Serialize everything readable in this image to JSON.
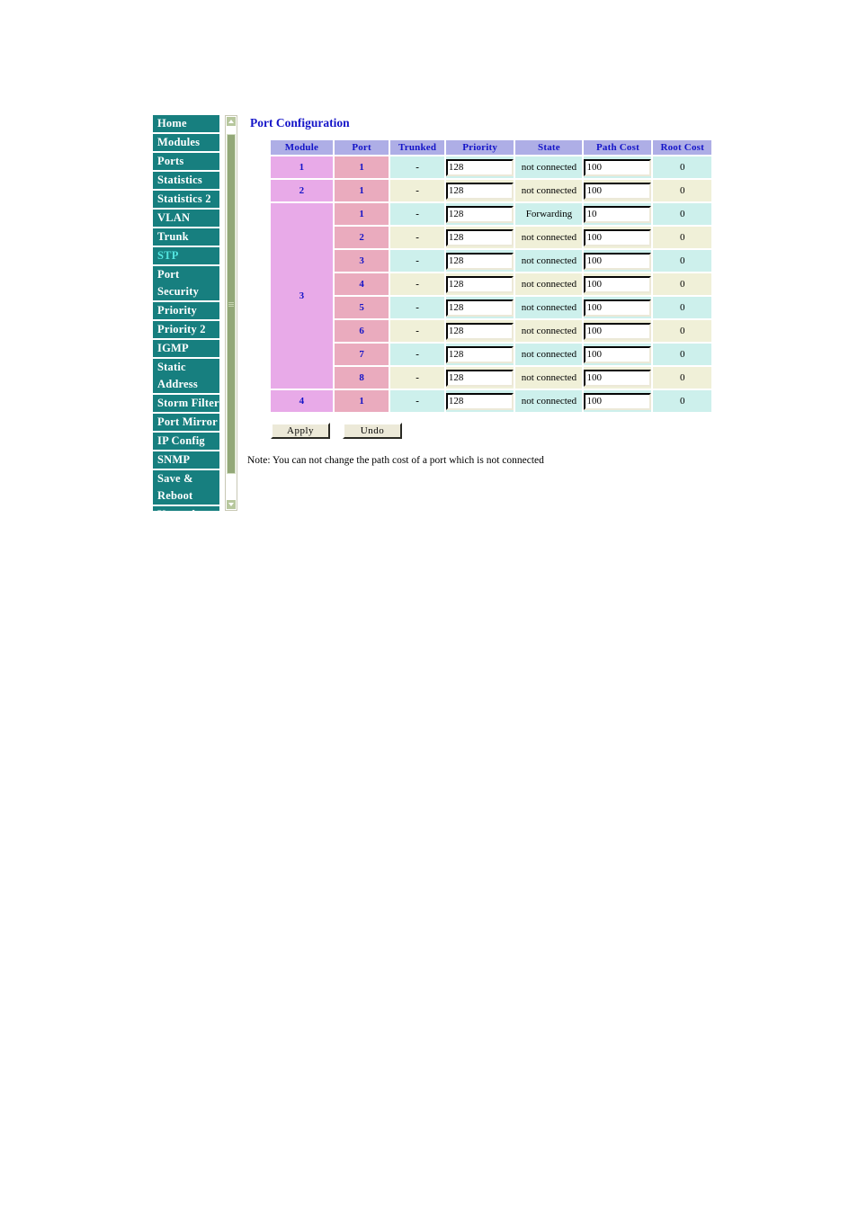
{
  "sidebar": {
    "items": [
      {
        "label": "Home",
        "active": false,
        "twoline": false,
        "clipped": false
      },
      {
        "label": "Modules",
        "active": false,
        "twoline": false,
        "clipped": false
      },
      {
        "label": "Ports",
        "active": false,
        "twoline": false,
        "clipped": false
      },
      {
        "label": "Statistics",
        "active": false,
        "twoline": false,
        "clipped": false
      },
      {
        "label": "Statistics 2",
        "active": false,
        "twoline": false,
        "clipped": false
      },
      {
        "label": "VLAN",
        "active": false,
        "twoline": false,
        "clipped": false
      },
      {
        "label": "Trunk",
        "active": false,
        "twoline": false,
        "clipped": false
      },
      {
        "label": "STP",
        "active": true,
        "twoline": false,
        "clipped": false
      },
      {
        "label": "Port Security",
        "active": false,
        "twoline": true,
        "clipped": false
      },
      {
        "label": "Priority",
        "active": false,
        "twoline": false,
        "clipped": false
      },
      {
        "label": "Priority 2",
        "active": false,
        "twoline": false,
        "clipped": false
      },
      {
        "label": "IGMP",
        "active": false,
        "twoline": false,
        "clipped": false
      },
      {
        "label": "Static Address",
        "active": false,
        "twoline": true,
        "clipped": false
      },
      {
        "label": "Storm Filter",
        "active": false,
        "twoline": false,
        "clipped": false
      },
      {
        "label": "Port Mirror",
        "active": false,
        "twoline": false,
        "clipped": false
      },
      {
        "label": "IP Config",
        "active": false,
        "twoline": false,
        "clipped": false
      },
      {
        "label": "SNMP",
        "active": false,
        "twoline": false,
        "clipped": false
      },
      {
        "label": "Save & Reboot",
        "active": false,
        "twoline": true,
        "clipped": false
      },
      {
        "label": "Upgrade",
        "active": false,
        "twoline": false,
        "clipped": true
      }
    ],
    "active_color": "#53e6e0",
    "background_color": "#177f7f"
  },
  "scrollbar": {
    "up_icon": "chevron-up-icon",
    "down_icon": "chevron-down-icon",
    "thumb_color": "#93a878"
  },
  "page": {
    "title": "Port Configuration",
    "title_color": "#1414c8"
  },
  "table": {
    "headers": [
      "Module",
      "Port",
      "Trunked",
      "Priority",
      "State",
      "Path Cost",
      "Root Cost"
    ],
    "header_bg": "#aeaee6",
    "module_cell_bg": "#e8aae8",
    "port_cell_bg": "#eaabbe",
    "row_bg_odd": "#cdf0ec",
    "row_bg_even": "#f0f0d8",
    "rows": [
      {
        "module": "1",
        "module_rowspan": 1,
        "port": "1",
        "trunked": "-",
        "priority": "128",
        "state": "not connected",
        "path_cost": "100",
        "root_cost": "0"
      },
      {
        "module": "2",
        "module_rowspan": 1,
        "port": "1",
        "trunked": "-",
        "priority": "128",
        "state": "not connected",
        "path_cost": "100",
        "root_cost": "0"
      },
      {
        "module": "3",
        "module_rowspan": 8,
        "port": "1",
        "trunked": "-",
        "priority": "128",
        "state": "Forwarding",
        "path_cost": "10",
        "root_cost": "0"
      },
      {
        "module": "",
        "module_rowspan": 0,
        "port": "2",
        "trunked": "-",
        "priority": "128",
        "state": "not connected",
        "path_cost": "100",
        "root_cost": "0"
      },
      {
        "module": "",
        "module_rowspan": 0,
        "port": "3",
        "trunked": "-",
        "priority": "128",
        "state": "not connected",
        "path_cost": "100",
        "root_cost": "0"
      },
      {
        "module": "",
        "module_rowspan": 0,
        "port": "4",
        "trunked": "-",
        "priority": "128",
        "state": "not connected",
        "path_cost": "100",
        "root_cost": "0"
      },
      {
        "module": "",
        "module_rowspan": 0,
        "port": "5",
        "trunked": "-",
        "priority": "128",
        "state": "not connected",
        "path_cost": "100",
        "root_cost": "0"
      },
      {
        "module": "",
        "module_rowspan": 0,
        "port": "6",
        "trunked": "-",
        "priority": "128",
        "state": "not connected",
        "path_cost": "100",
        "root_cost": "0"
      },
      {
        "module": "",
        "module_rowspan": 0,
        "port": "7",
        "trunked": "-",
        "priority": "128",
        "state": "not connected",
        "path_cost": "100",
        "root_cost": "0"
      },
      {
        "module": "",
        "module_rowspan": 0,
        "port": "8",
        "trunked": "-",
        "priority": "128",
        "state": "not connected",
        "path_cost": "100",
        "root_cost": "0"
      },
      {
        "module": "4",
        "module_rowspan": 1,
        "port": "1",
        "trunked": "-",
        "priority": "128",
        "state": "not connected",
        "path_cost": "100",
        "root_cost": "0"
      }
    ]
  },
  "buttons": {
    "apply_label": "Apply",
    "undo_label": "Undo"
  },
  "note": {
    "text": "Note: You can not change the path cost of a port which is not connected"
  }
}
